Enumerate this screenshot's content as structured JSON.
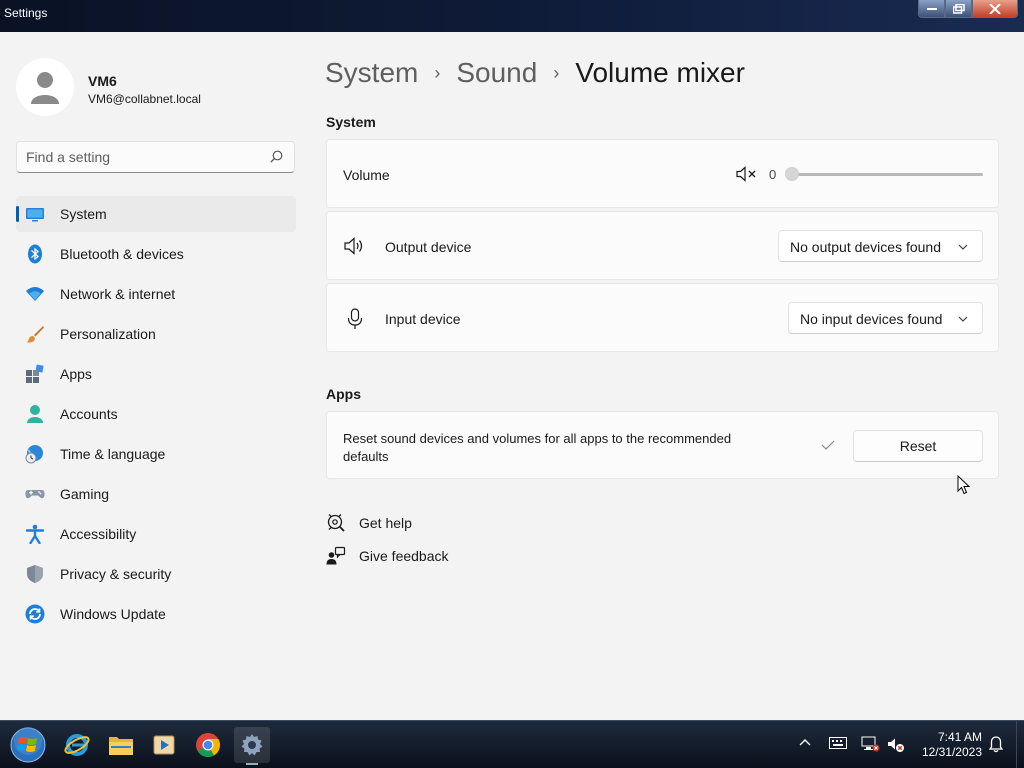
{
  "window": {
    "title": "Settings"
  },
  "user": {
    "name": "VM6",
    "email": "VM6@collabnet.local"
  },
  "search": {
    "placeholder": "Find a setting"
  },
  "nav": [
    {
      "label": "System",
      "icon": "system-icon",
      "active": true
    },
    {
      "label": "Bluetooth & devices",
      "icon": "bluetooth-icon"
    },
    {
      "label": "Network & internet",
      "icon": "wifi-icon"
    },
    {
      "label": "Personalization",
      "icon": "brush-icon"
    },
    {
      "label": "Apps",
      "icon": "apps-icon"
    },
    {
      "label": "Accounts",
      "icon": "accounts-icon"
    },
    {
      "label": "Time & language",
      "icon": "globe-clock-icon"
    },
    {
      "label": "Gaming",
      "icon": "gamepad-icon"
    },
    {
      "label": "Accessibility",
      "icon": "accessibility-icon"
    },
    {
      "label": "Privacy & security",
      "icon": "shield-icon"
    },
    {
      "label": "Windows Update",
      "icon": "update-icon"
    }
  ],
  "breadcrumb": {
    "items": [
      "System",
      "Sound"
    ],
    "current": "Volume mixer",
    "separator": "›"
  },
  "system_section": {
    "title": "System",
    "volume": {
      "label": "Volume",
      "value": "0",
      "level": 0
    },
    "output": {
      "label": "Output device",
      "selected": "No output devices found"
    },
    "input": {
      "label": "Input device",
      "selected": "No input devices found"
    }
  },
  "apps_section": {
    "title": "Apps",
    "reset_text": "Reset sound devices and volumes for all apps to the recommended defaults",
    "reset_button": "Reset"
  },
  "links": {
    "help": "Get help",
    "feedback": "Give feedback"
  },
  "taskbar": {
    "apps": [
      "start-orb-icon",
      "internet-explorer-icon",
      "file-explorer-icon",
      "media-player-icon",
      "chrome-icon",
      "settings-gear-icon"
    ],
    "time": "7:41 AM",
    "date": "12/31/2023"
  },
  "colors": {
    "accent": "#005fb8",
    "background": "#f3f3f3",
    "card": "#fbfbfb"
  }
}
